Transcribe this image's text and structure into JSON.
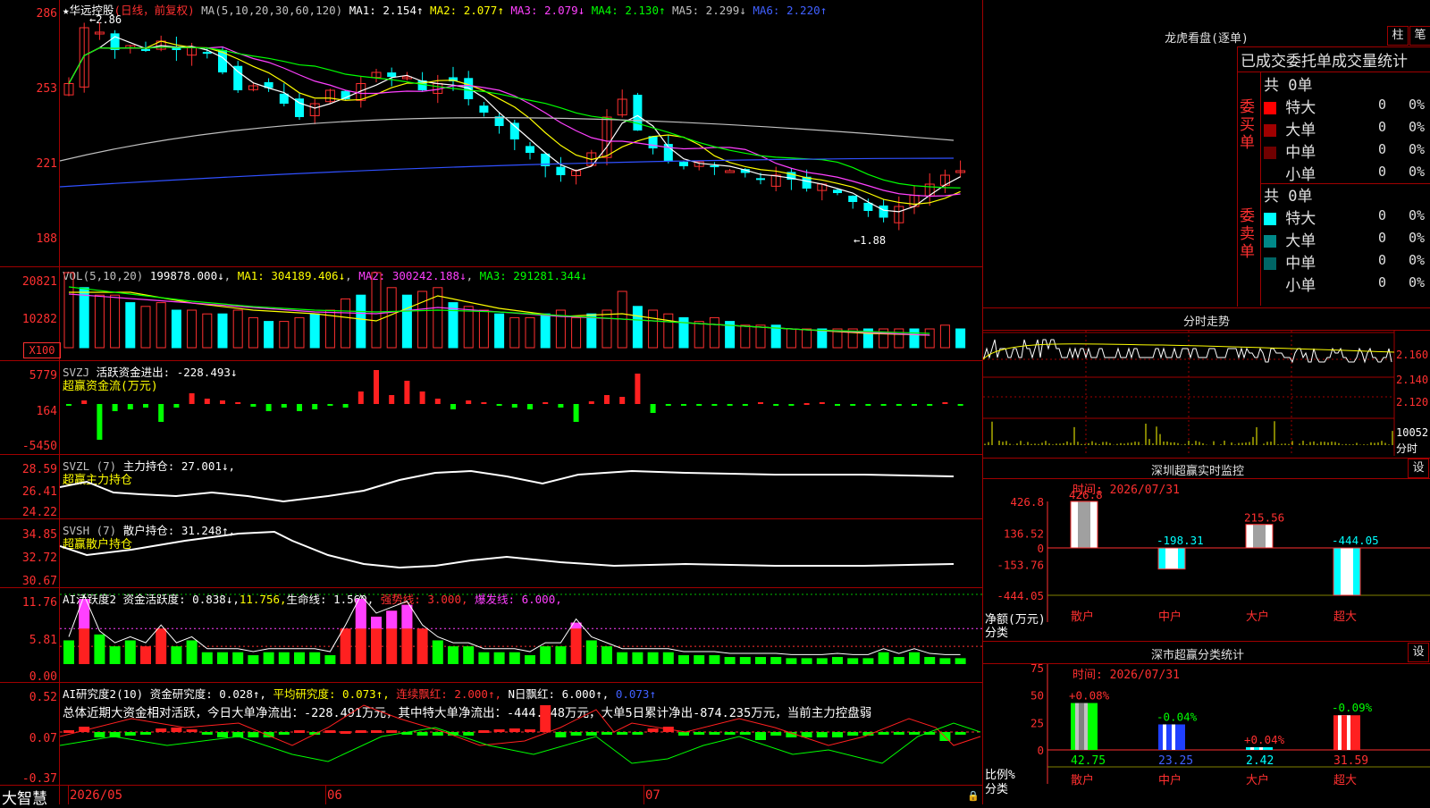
{
  "stock": {
    "name": "华远控股",
    "mode": "(日线，前复权)"
  },
  "main_chart": {
    "ma_label": "MA(5,10,20,30,60,120)",
    "ma": [
      {
        "name": "MA1",
        "value": "2.154↑",
        "color": "#ffffff"
      },
      {
        "name": "MA2",
        "value": "2.077↑",
        "color": "#ffff00"
      },
      {
        "name": "MA3",
        "value": "2.079↓",
        "color": "#ff40ff"
      },
      {
        "name": "MA4",
        "value": "2.130↑",
        "color": "#00ff00"
      },
      {
        "name": "MA5",
        "value": "2.299↓",
        "color": "#c0c0c0"
      },
      {
        "name": "MA6",
        "value": "2.220↑",
        "color": "#4060ff"
      }
    ],
    "y_ticks": [
      "286",
      "253",
      "221",
      "188"
    ],
    "high_mark": "2.86",
    "low_mark": "1.88"
  },
  "vol": {
    "title": "VOL(5,10,20)",
    "value": "199878.000↓",
    "ma1": "MA1: 304189.406↓",
    "ma2": "MA2: 300242.188↓",
    "ma3": "MA3: 291281.344↓",
    "y_ticks": [
      "20821",
      "10282"
    ],
    "unit": "X100"
  },
  "svzj": {
    "title": "SVZJ",
    "label": "活跃资金进出:",
    "value": "-228.493↓",
    "sub": "超赢资金流(万元)",
    "y_ticks": [
      "5779",
      "164",
      "-5450"
    ]
  },
  "svzl": {
    "title": "SVZL (7)",
    "label": "主力持仓:",
    "value": "27.001↓,",
    "sub": "超赢主力持仓",
    "y_ticks": [
      "28.59",
      "26.41",
      "24.22"
    ]
  },
  "svsh": {
    "title": "SVSH (7)",
    "label": "散户持仓:",
    "value": "31.248↑,",
    "sub": "超赢散户持仓",
    "y_ticks": [
      "34.85",
      "32.72",
      "30.67"
    ]
  },
  "ai_active": {
    "title": "AI活跃度2",
    "label": "资金活跃度:",
    "value": "0.838↓,",
    "v2": "11.756,",
    "life": "生命线: 1.560,",
    "strong": "强势线: 3.000,",
    "burst": "爆发线: 6.000,",
    "y_ticks": [
      "11.76",
      "5.81",
      "0.00"
    ]
  },
  "ai_research": {
    "title": "AI研究度2(10)",
    "label": "资金研究度:",
    "value": "0.028↑,",
    "avg": "平均研究度: 0.073↑,",
    "lianxu": "连续飘红: 2.000↑,",
    "nday": "N日飘红: 6.000↑,",
    "last": "0.073↑",
    "summary": "总体近期大资金相对活跃，今日大单净流出：-228.491万元，其中特大单净流出：-444.048万元，大单5日累计净出-874.235万元，当前主力控盘弱",
    "y_ticks": [
      "0.52",
      "0.07",
      "-0.37"
    ]
  },
  "bottom_bar": {
    "brand": "大智慧",
    "dates": [
      "2026/05",
      "06",
      "07"
    ]
  },
  "right": {
    "lhb_title": "龙虎看盘(逐单)",
    "btn_zhu": "柱",
    "btn_bi": "笔",
    "order_header": "已成交委托单成交量统计",
    "buy": {
      "label": "委买单",
      "total": "共 0单",
      "rows": [
        {
          "name": "特大",
          "count": "0",
          "pct": "0%",
          "color": "#ff0000"
        },
        {
          "name": "大单",
          "count": "0",
          "pct": "0%",
          "color": "#a00000"
        },
        {
          "name": "中单",
          "count": "0",
          "pct": "0%",
          "color": "#700000"
        },
        {
          "name": "小单",
          "count": "0",
          "pct": "0%",
          "color": "#000000"
        }
      ]
    },
    "sell": {
      "label": "委卖单",
      "total": "共 0单",
      "rows": [
        {
          "name": "特大",
          "count": "0",
          "pct": "0%",
          "color": "#00ffff"
        },
        {
          "name": "大单",
          "count": "0",
          "pct": "0%",
          "color": "#008888"
        },
        {
          "name": "中单",
          "count": "0",
          "pct": "0%",
          "color": "#006666"
        },
        {
          "name": "小单",
          "count": "0",
          "pct": "0%",
          "color": "#000000"
        }
      ]
    },
    "fenshi": {
      "title": "分时走势",
      "y_ticks": [
        "2.160",
        "2.140",
        "2.120"
      ],
      "vol": "10052",
      "vol_unit": "分时"
    },
    "sz_monitor": {
      "title": "深圳超赢实时监控",
      "btn": "设",
      "time": "时间: 2026/07/31",
      "ylabel": "净额(万元)",
      "xlabel": "分类",
      "y_ticks": [
        "426.8",
        "136.52",
        "0",
        "-153.76",
        "-444.05"
      ],
      "bars": [
        {
          "cat": "散户",
          "value": 426.8,
          "label": "426.8"
        },
        {
          "cat": "中户",
          "value": -198.31,
          "label": "-198.31"
        },
        {
          "cat": "大户",
          "value": 215.56,
          "label": "215.56"
        },
        {
          "cat": "超大",
          "value": -444.05,
          "label": "-444.05"
        }
      ]
    },
    "sz_class": {
      "title": "深市超赢分类统计",
      "btn": "设",
      "time": "时间: 2026/07/31",
      "ylabel": "比例%",
      "xlabel": "分类",
      "y_ticks": [
        "75",
        "50",
        "25",
        "0"
      ],
      "bars": [
        {
          "cat": "散户",
          "value": 42.75,
          "label": "42.75",
          "change": "+0.08%",
          "color": "#00ff00"
        },
        {
          "cat": "中户",
          "value": 23.25,
          "label": "23.25",
          "change": "-0.04%",
          "color": "#2040ff"
        },
        {
          "cat": "大户",
          "value": 2.42,
          "label": "2.42",
          "change": "+0.04%",
          "color": "#00ffff"
        },
        {
          "cat": "超大",
          "value": 31.59,
          "label": "31.59",
          "change": "-0.09%",
          "color": "#ff2020"
        }
      ]
    }
  },
  "chart_data": [
    {
      "type": "bar",
      "title": "深圳超赢实时监控",
      "categories": [
        "散户",
        "中户",
        "大户",
        "超大"
      ],
      "values": [
        426.8,
        -198.31,
        215.56,
        -444.05
      ],
      "ylabel": "净额(万元)",
      "xlabel": "分类",
      "ylim": [
        -444.05,
        426.8
      ]
    },
    {
      "type": "bar",
      "title": "深市超赢分类统计",
      "categories": [
        "散户",
        "中户",
        "大户",
        "超大"
      ],
      "values": [
        42.75,
        23.25,
        2.42,
        31.59
      ],
      "ylabel": "比例%",
      "xlabel": "分类",
      "ylim": [
        0,
        75
      ]
    }
  ]
}
